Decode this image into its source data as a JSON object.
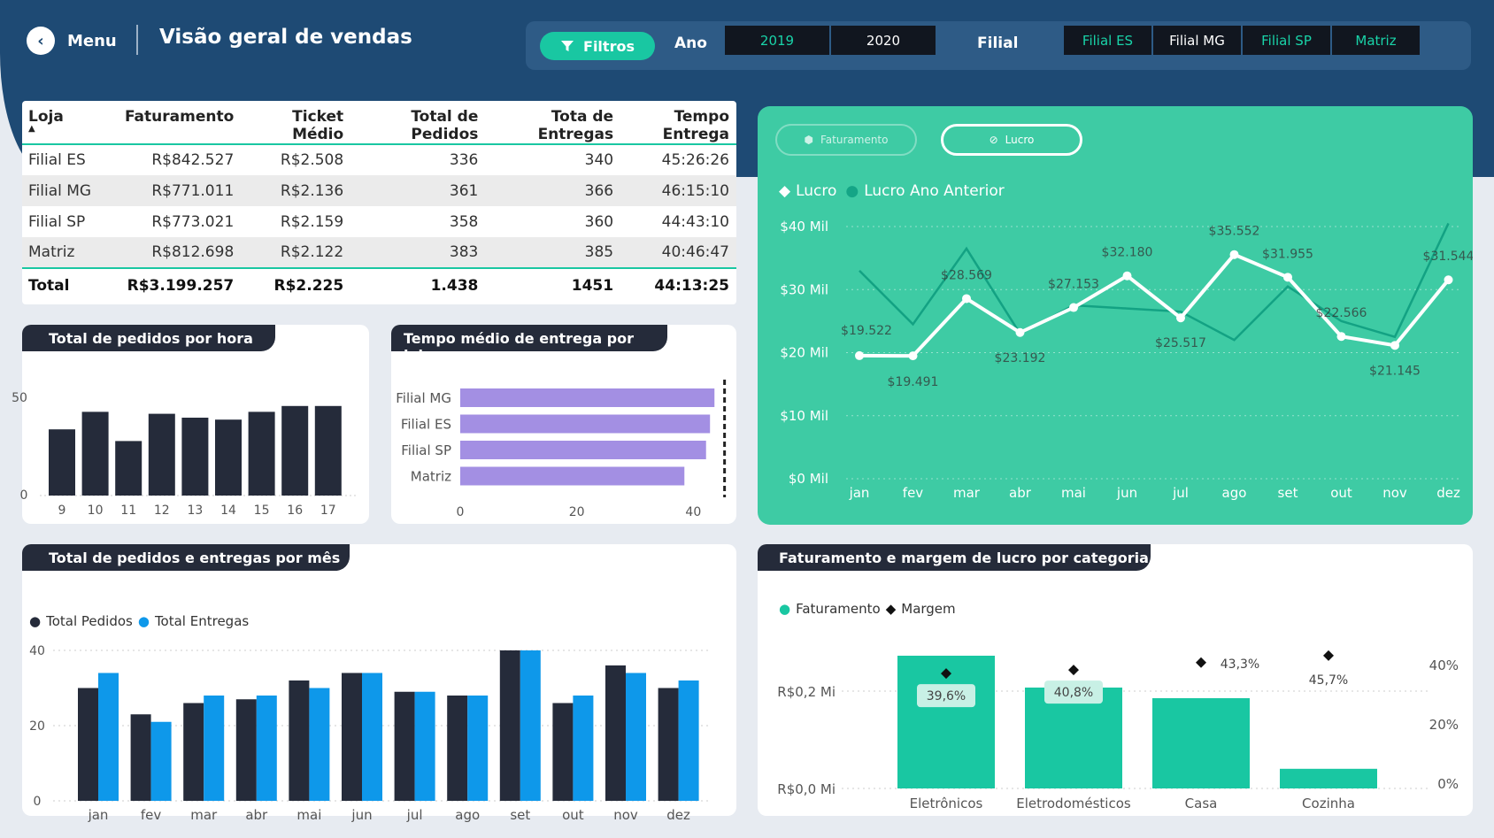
{
  "header": {
    "menu_label": "Menu",
    "title": "Visão geral de vendas"
  },
  "filters": {
    "filter_label": "Filtros",
    "ano_label": "Ano",
    "filial_label": "Filial",
    "years": [
      "2019",
      "2020"
    ],
    "branches": [
      "Filial ES",
      "Filial MG",
      "Filial SP",
      "Matriz"
    ]
  },
  "table": {
    "headers": [
      "Loja",
      "Faturamento",
      "Ticket Médio",
      "Total de Pedidos",
      "Tota de Entregas",
      "Tempo Entrega"
    ],
    "rows": [
      [
        "Filial ES",
        "R$842.527",
        "R$2.508",
        "336",
        "340",
        "45:26:26"
      ],
      [
        "Filial MG",
        "R$771.011",
        "R$2.136",
        "361",
        "366",
        "46:15:10"
      ],
      [
        "Filial SP",
        "R$773.021",
        "R$2.159",
        "358",
        "360",
        "44:43:10"
      ],
      [
        "Matriz",
        "R$812.698",
        "R$2.122",
        "383",
        "385",
        "40:46:47"
      ]
    ],
    "total": [
      "Total",
      "R$3.199.257",
      "R$2.225",
      "1.438",
      "1451",
      "44:13:25"
    ]
  },
  "profit_card": {
    "toggle_1": "Faturamento",
    "toggle_2": "Lucro",
    "toggle_active": "Lucro"
  },
  "colors": {
    "accent": "#19c7a2",
    "dark": "#252b3a",
    "blue": "#0e98ea",
    "purple": "#a38fe3",
    "header": "#1e4a74",
    "panel": "#3ecba4"
  },
  "chart_data": [
    {
      "type": "bar",
      "title": "Total de pedidos por hora",
      "categories": [
        "9",
        "10",
        "11",
        "12",
        "13",
        "14",
        "15",
        "16",
        "17"
      ],
      "values": [
        34,
        43,
        28,
        42,
        40,
        39,
        43,
        46,
        46
      ],
      "ylim": [
        0,
        50
      ],
      "yticks": [
        "0",
        "50"
      ]
    },
    {
      "type": "bar",
      "orientation": "horizontal",
      "title": "Tempo médio de entrega por loja",
      "categories": [
        "Filial MG",
        "Filial ES",
        "Filial SP",
        "Matriz"
      ],
      "values": [
        46.25,
        45.44,
        44.72,
        40.78
      ],
      "reference_line": 44.22,
      "xlim": [
        0,
        47.5
      ],
      "xticks": [
        "0",
        "20",
        "40"
      ]
    },
    {
      "type": "line",
      "categories": [
        "jan",
        "fev",
        "mar",
        "abr",
        "mai",
        "jun",
        "jul",
        "ago",
        "set",
        "out",
        "nov",
        "dez"
      ],
      "series": [
        {
          "name": "Lucro",
          "values": [
            19522,
            19491,
            28569,
            23192,
            27153,
            32180,
            25517,
            35552,
            31955,
            22566,
            21145,
            31544
          ],
          "labels": [
            "$19.522",
            "$19.491",
            "$28.569",
            "$23.192",
            "$27.153",
            "$32.180",
            "$25.517",
            "$35.552",
            "$31.955",
            "$22.566",
            "$21.145",
            "$31.544"
          ]
        },
        {
          "name": "Lucro Ano Anterior",
          "values": [
            33000,
            24500,
            36500,
            23000,
            27500,
            27000,
            26500,
            22000,
            30500,
            25000,
            22500,
            40500
          ]
        }
      ],
      "ylim": [
        0,
        40000
      ],
      "yticks": [
        "$0 Mil",
        "$10 Mil",
        "$20 Mil",
        "$30 Mil",
        "$40 Mil"
      ]
    },
    {
      "type": "bar",
      "title": "Total de pedidos e entregas por mês",
      "categories": [
        "jan",
        "fev",
        "mar",
        "abr",
        "mai",
        "jun",
        "jul",
        "ago",
        "set",
        "out",
        "nov",
        "dez"
      ],
      "series": [
        {
          "name": "Total Pedidos",
          "values": [
            30,
            23,
            26,
            27,
            32,
            34,
            29,
            28,
            40,
            26,
            36,
            30
          ]
        },
        {
          "name": "Total Entregas",
          "values": [
            34,
            21,
            28,
            28,
            30,
            34,
            29,
            28,
            40,
            28,
            34,
            32
          ]
        }
      ],
      "ylim": [
        0,
        40
      ],
      "yticks": [
        "0",
        "20",
        "40"
      ]
    },
    {
      "type": "bar",
      "title": "Faturamento e margem de lucro por categoria",
      "categories": [
        "Eletrônicos",
        "Eletrodomésticos",
        "Casa",
        "Cozinha"
      ],
      "series": [
        {
          "name": "Faturamento",
          "values": [
            0.25,
            0.19,
            0.17,
            0.037
          ]
        },
        {
          "name": "Margem",
          "values": [
            39.6,
            40.8,
            43.3,
            45.7
          ],
          "labels": [
            "39,6%",
            "40,8%",
            "43,3%",
            "45,7%"
          ]
        }
      ],
      "ylim": [
        0,
        0.27
      ],
      "yticks": [
        "R$0,0 Mi",
        "R$0,2 Mi"
      ],
      "y2ticks": [
        "0%",
        "20%",
        "40%"
      ]
    }
  ]
}
